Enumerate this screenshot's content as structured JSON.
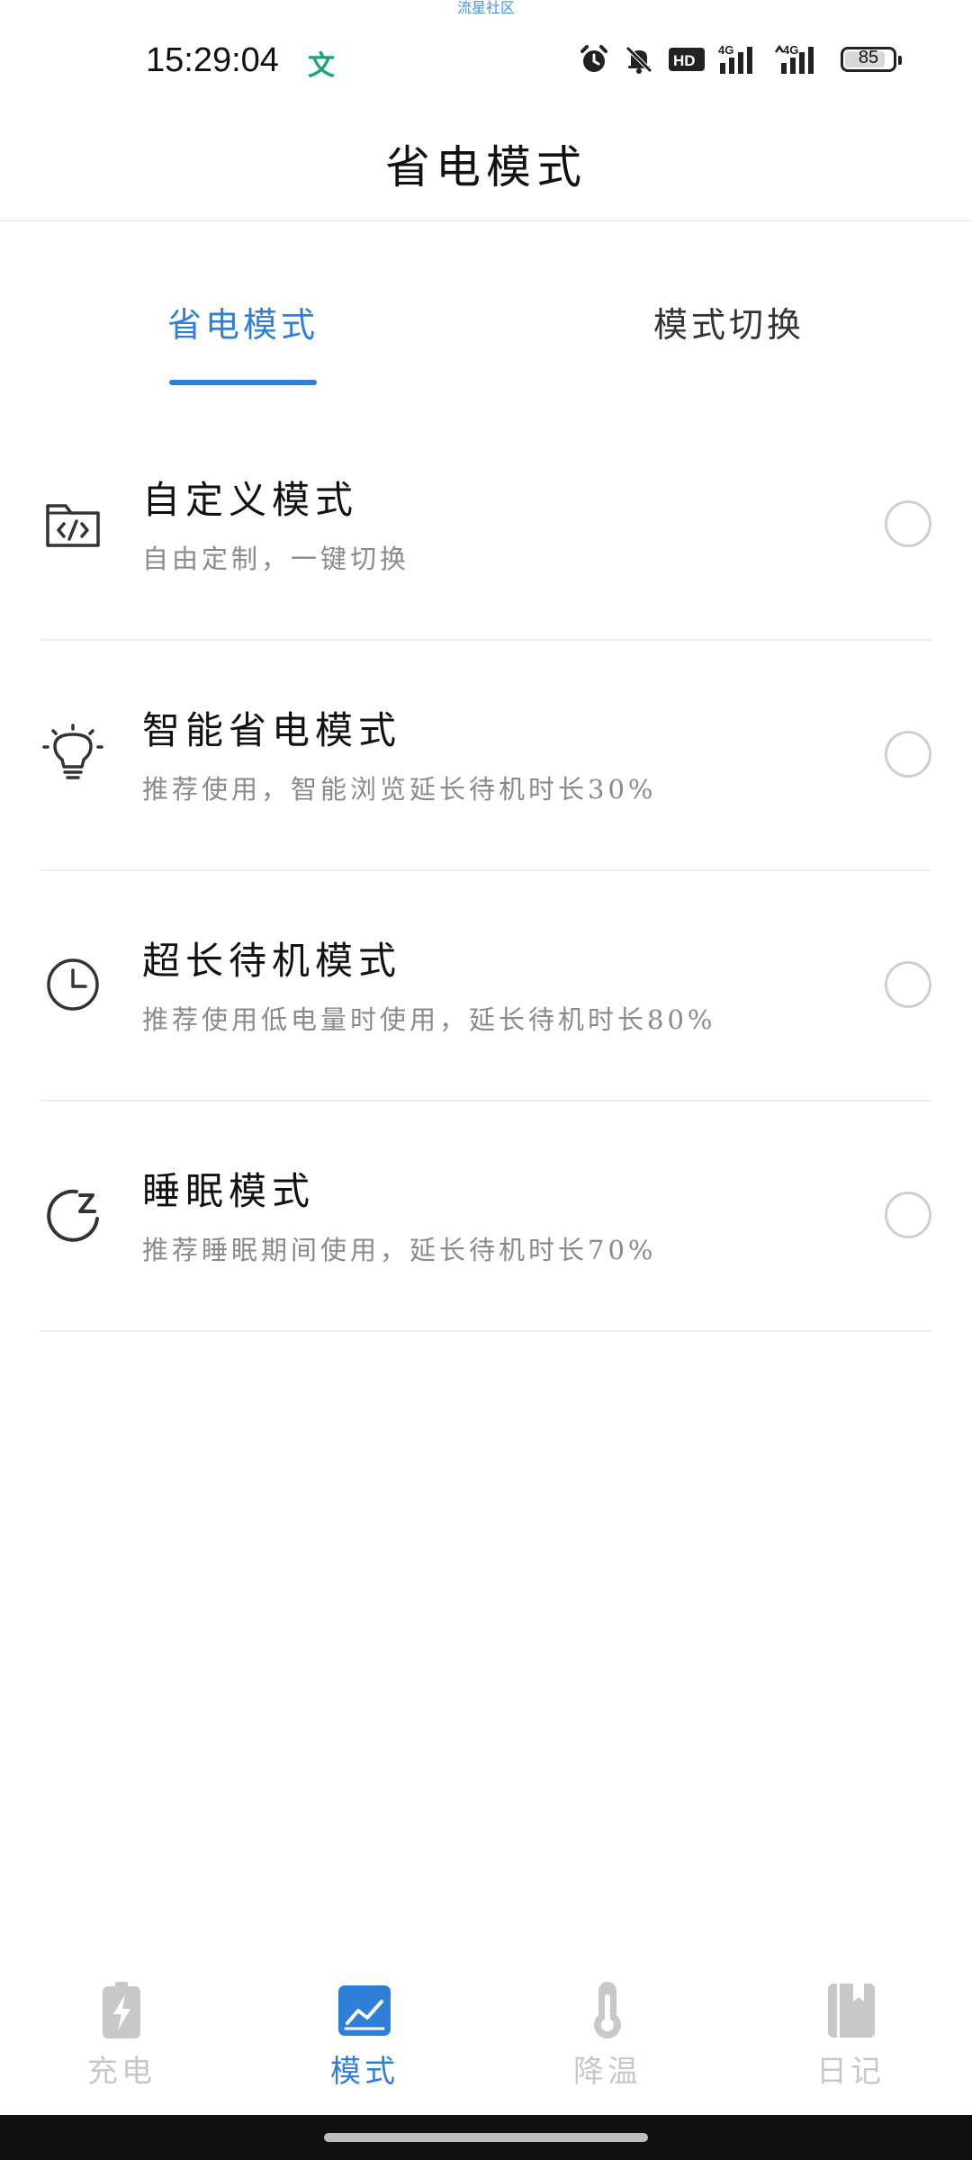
{
  "watermark": "流星社区",
  "status_bar": {
    "time": "15:29:04",
    "ime": "文",
    "battery": "85",
    "battery_level": 0.85,
    "network_1": "4G",
    "network_2": "4G",
    "hd_label": "HD"
  },
  "header": {
    "title": "省电模式"
  },
  "tabs": [
    {
      "label": "省电模式",
      "active": true
    },
    {
      "label": "模式切换",
      "active": false
    }
  ],
  "modes": [
    {
      "title": "自定义模式",
      "desc": "自由定制，一键切换",
      "icon": "folder-code-icon",
      "selected": false
    },
    {
      "title": "智能省电模式",
      "desc": "推荐使用，智能浏览延长待机时长30%",
      "icon": "lightbulb-icon",
      "selected": false
    },
    {
      "title": "超长待机模式",
      "desc": "推荐使用低电量时使用，延长待机时长80%",
      "icon": "clock-icon",
      "selected": false
    },
    {
      "title": "睡眠模式",
      "desc": "推荐睡眠期间使用，延长待机时长70%",
      "icon": "moon-sleep-icon",
      "selected": false
    }
  ],
  "bottom_nav": [
    {
      "label": "充电",
      "icon": "battery-charge-icon",
      "active": false
    },
    {
      "label": "模式",
      "icon": "chart-image-icon",
      "active": true
    },
    {
      "label": "降温",
      "icon": "thermometer-icon",
      "active": false
    },
    {
      "label": "日记",
      "icon": "notebook-icon",
      "active": false
    }
  ],
  "colors": {
    "accent": "#2f7fd8",
    "inactive_nav": "#c8c8c8",
    "desc_text": "#8a8a8a",
    "divider": "#ececec"
  }
}
